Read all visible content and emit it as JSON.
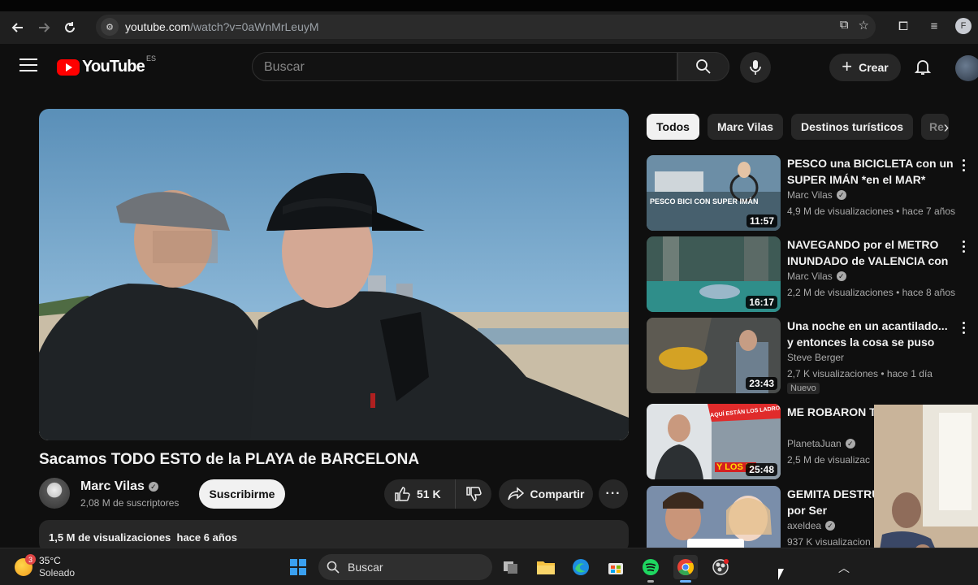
{
  "browser": {
    "url_host": "youtube.com",
    "url_path": "/watch?v=0aWnMrLeuyM",
    "profile_initial": "F"
  },
  "header": {
    "logo_text": "YouTube",
    "region": "ES",
    "search_placeholder": "Buscar",
    "create_label": "Crear"
  },
  "video": {
    "title": "Sacamos TODO ESTO de la PLAYA de BARCELONA",
    "channel": "Marc Vilas",
    "subscribers": "2,08 M de suscriptores",
    "subscribe_label": "Suscribirme",
    "likes": "51 K",
    "share_label": "Compartir",
    "more_label": "···",
    "stats": "1,5 M de visualizaciones  hace 6 años"
  },
  "chips": [
    {
      "label": "Todos"
    },
    {
      "label": "Marc Vilas"
    },
    {
      "label": "Destinos turísticos"
    },
    {
      "label": "Re"
    }
  ],
  "recommendations": [
    {
      "title": "PESCO una BICICLETA con un SUPER IMÁN *en el MAR*",
      "channel": "Marc Vilas",
      "meta": "4,9 M de visualizaciones • hace 7 años",
      "duration": "11:57",
      "thumb_text": "PESCO BICI CON SUPER IMÁN"
    },
    {
      "title": "NAVEGANDO por el METRO INUNDADO de VALENCIA con ...",
      "channel": "Marc Vilas",
      "meta": "2,2 M de visualizaciones • hace 8 años",
      "duration": "16:17"
    },
    {
      "title": "Una noche en un acantilado... y entonces la cosa se puso seria",
      "channel": "Steve Berger",
      "meta": "2,7 K visualizaciones • hace 1 día",
      "duration": "23:43",
      "badge": "Nuevo"
    },
    {
      "title": "ME ROBARON TO ESPAÑA",
      "channel": "PlanetaJuan",
      "meta": "2,5 M de visualizac",
      "duration": "25:48",
      "thumb_text": "AQUÍ ESTÁN LOS LADRONES",
      "thumb_text2": "Y LOS P!"
    },
    {
      "title": "GEMITA DESTRUY CARRERA por Ser",
      "channel": "axeldea",
      "meta": "937 K visualizacion"
    }
  ],
  "taskbar": {
    "temperature": "35°C",
    "condition": "Soleado",
    "weather_badge": "3",
    "search_label": "Buscar"
  }
}
